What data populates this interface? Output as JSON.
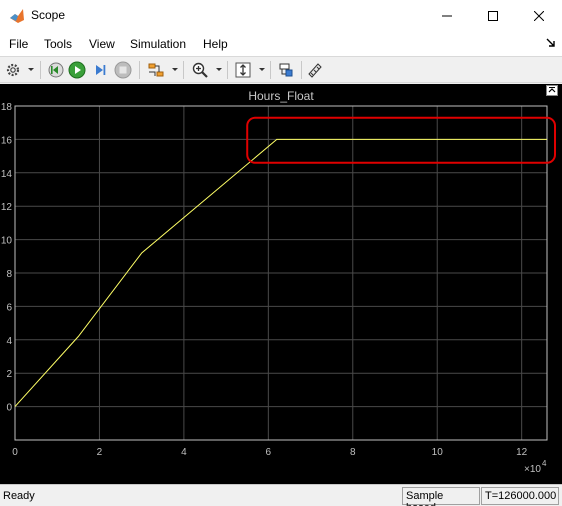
{
  "window": {
    "title": "Scope"
  },
  "menu": {
    "items": [
      {
        "name": "menu-file",
        "label": "File"
      },
      {
        "name": "menu-tools",
        "label": "Tools"
      },
      {
        "name": "menu-view",
        "label": "View"
      },
      {
        "name": "menu-simulation",
        "label": "Simulation"
      },
      {
        "name": "menu-help",
        "label": "Help"
      }
    ]
  },
  "toolbar": {
    "icons": [
      "gear-icon",
      "step-back-icon",
      "run-icon",
      "step-forward-icon",
      "stop-icon",
      "signal-select-icon",
      "zoom-icon",
      "autoscale-icon",
      "highlight-simulink-block-icon",
      "cursor-measurements-icon"
    ]
  },
  "plot": {
    "title": "Hours_Float"
  },
  "chart_data": {
    "type": "line",
    "title": "Hours_Float",
    "xlabel": "",
    "ylabel": "",
    "x_multiplier_label": "×10",
    "x_multiplier_exponent": "4",
    "xlim": [
      0,
      12.6
    ],
    "ylim": [
      -2,
      18
    ],
    "x_ticks": [
      "0",
      "2",
      "4",
      "6",
      "8",
      "10",
      "12"
    ],
    "y_ticks": [
      "0",
      "2",
      "4",
      "6",
      "8",
      "10",
      "12",
      "14",
      "16",
      "18"
    ],
    "grid": true,
    "background": "#000000",
    "line_color": "#ffff66",
    "series": [
      {
        "x": [
          0,
          1.5,
          3.0,
          6.2,
          12.6
        ],
        "y": [
          0,
          4.2,
          9.2,
          16.0,
          16.0
        ]
      }
    ],
    "annotation": {
      "type": "rectangle",
      "color": "#e00000",
      "x_range": [
        5.5,
        12.6
      ],
      "y_range": [
        14.6,
        17.3
      ]
    }
  },
  "status": {
    "ready": "Ready",
    "mode": "Sample based",
    "time": "T=126000.000"
  }
}
